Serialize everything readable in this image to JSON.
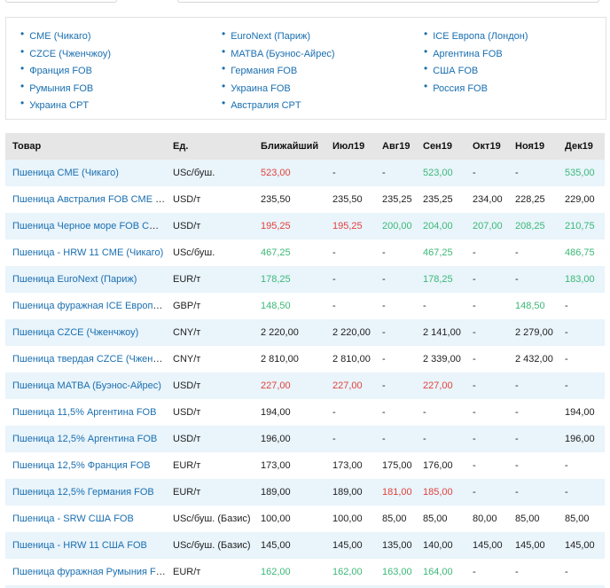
{
  "exchanges": {
    "col1": [
      "CME (Чикаго)",
      "CZCE (Чженчжоу)",
      "Франция FOB",
      "Румыния FOB",
      "Украина CPT"
    ],
    "col2": [
      "EuroNext (Париж)",
      "MATBA (Буэнос-Айрес)",
      "Германия FOB",
      "Украина FOB",
      "Австралия CPT"
    ],
    "col3": [
      "ICE Европа (Лондон)",
      "Аргентина FOB",
      "США FOB",
      "Россия FOB"
    ]
  },
  "colors": {
    "link": "#1a6fb0",
    "red": "#e2423b",
    "green": "#3cb878",
    "alt_row": "#e9f4fb",
    "header_bg": "#e6e6e6"
  },
  "table": {
    "headers": [
      "Товар",
      "Ед.",
      "Ближайший",
      "Июл19",
      "Авг19",
      "Сен19",
      "Окт19",
      "Ноя19",
      "Дек19"
    ],
    "rows": [
      {
        "name": "Пшеница CME (Чикаго)",
        "unit": "USc/буш.",
        "cells": [
          [
            "523,00",
            "red"
          ],
          [
            "-",
            "plain"
          ],
          [
            "-",
            "plain"
          ],
          [
            "523,00",
            "green"
          ],
          [
            "-",
            "plain"
          ],
          [
            "-",
            "plain"
          ],
          [
            "535,00",
            "green"
          ]
        ]
      },
      {
        "name": "Пшеница Австралия FOB CME (Ч…",
        "unit": "USD/т",
        "cells": [
          [
            "235,50",
            "plain"
          ],
          [
            "235,50",
            "plain"
          ],
          [
            "235,25",
            "plain"
          ],
          [
            "235,25",
            "plain"
          ],
          [
            "234,00",
            "plain"
          ],
          [
            "228,25",
            "plain"
          ],
          [
            "229,00",
            "plain"
          ]
        ]
      },
      {
        "name": "Пшеница Черное море FOB CME …",
        "unit": "USD/т",
        "cells": [
          [
            "195,25",
            "red"
          ],
          [
            "195,25",
            "red"
          ],
          [
            "200,00",
            "green"
          ],
          [
            "204,00",
            "green"
          ],
          [
            "207,00",
            "green"
          ],
          [
            "208,25",
            "green"
          ],
          [
            "210,75",
            "green"
          ]
        ]
      },
      {
        "name": "Пшеница - HRW 11 CME (Чикаго)",
        "unit": "USc/буш.",
        "cells": [
          [
            "467,25",
            "green"
          ],
          [
            "-",
            "plain"
          ],
          [
            "-",
            "plain"
          ],
          [
            "467,25",
            "green"
          ],
          [
            "-",
            "plain"
          ],
          [
            "-",
            "plain"
          ],
          [
            "486,75",
            "green"
          ]
        ]
      },
      {
        "name": "Пшеница EuroNext (Париж)",
        "unit": "EUR/т",
        "cells": [
          [
            "178,25",
            "green"
          ],
          [
            "-",
            "plain"
          ],
          [
            "-",
            "plain"
          ],
          [
            "178,25",
            "green"
          ],
          [
            "-",
            "plain"
          ],
          [
            "-",
            "plain"
          ],
          [
            "183,00",
            "green"
          ]
        ]
      },
      {
        "name": "Пшеница фуражная ICE Европа …",
        "unit": "GBP/т",
        "cells": [
          [
            "148,50",
            "green"
          ],
          [
            "-",
            "plain"
          ],
          [
            "-",
            "plain"
          ],
          [
            "-",
            "plain"
          ],
          [
            "-",
            "plain"
          ],
          [
            "148,50",
            "green"
          ],
          [
            "-",
            "plain"
          ]
        ]
      },
      {
        "name": "Пшеница CZCE (Чженчжоу)",
        "unit": "CNY/т",
        "cells": [
          [
            "2 220,00",
            "plain"
          ],
          [
            "2 220,00",
            "plain"
          ],
          [
            "-",
            "plain"
          ],
          [
            "2 141,00",
            "plain"
          ],
          [
            "-",
            "plain"
          ],
          [
            "2 279,00",
            "plain"
          ],
          [
            "-",
            "plain"
          ]
        ]
      },
      {
        "name": "Пшеница твердая CZCE (Чженч…",
        "unit": "CNY/т",
        "cells": [
          [
            "2 810,00",
            "plain"
          ],
          [
            "2 810,00",
            "plain"
          ],
          [
            "-",
            "plain"
          ],
          [
            "2 339,00",
            "plain"
          ],
          [
            "-",
            "plain"
          ],
          [
            "2 432,00",
            "plain"
          ],
          [
            "-",
            "plain"
          ]
        ]
      },
      {
        "name": "Пшеница MATBA (Буэнос-Айрес)",
        "unit": "USD/т",
        "cells": [
          [
            "227,00",
            "red"
          ],
          [
            "227,00",
            "red"
          ],
          [
            "-",
            "plain"
          ],
          [
            "227,00",
            "red"
          ],
          [
            "-",
            "plain"
          ],
          [
            "-",
            "plain"
          ],
          [
            "-",
            "plain"
          ]
        ]
      },
      {
        "name": "Пшеница 11,5% Аргентина FOB",
        "unit": "USD/т",
        "cells": [
          [
            "194,00",
            "plain"
          ],
          [
            "-",
            "plain"
          ],
          [
            "-",
            "plain"
          ],
          [
            "-",
            "plain"
          ],
          [
            "-",
            "plain"
          ],
          [
            "-",
            "plain"
          ],
          [
            "194,00",
            "plain"
          ]
        ]
      },
      {
        "name": "Пшеница 12,5% Аргентина FOB",
        "unit": "USD/т",
        "cells": [
          [
            "196,00",
            "plain"
          ],
          [
            "-",
            "plain"
          ],
          [
            "-",
            "plain"
          ],
          [
            "-",
            "plain"
          ],
          [
            "-",
            "plain"
          ],
          [
            "-",
            "plain"
          ],
          [
            "196,00",
            "plain"
          ]
        ]
      },
      {
        "name": "Пшеница 12,5% Франция FOB",
        "unit": "EUR/т",
        "cells": [
          [
            "173,00",
            "plain"
          ],
          [
            "173,00",
            "plain"
          ],
          [
            "175,00",
            "plain"
          ],
          [
            "176,00",
            "plain"
          ],
          [
            "-",
            "plain"
          ],
          [
            "-",
            "plain"
          ],
          [
            "-",
            "plain"
          ]
        ]
      },
      {
        "name": "Пшеница 12,5% Германия FOB",
        "unit": "EUR/т",
        "cells": [
          [
            "189,00",
            "plain"
          ],
          [
            "189,00",
            "plain"
          ],
          [
            "181,00",
            "red"
          ],
          [
            "185,00",
            "red"
          ],
          [
            "-",
            "plain"
          ],
          [
            "-",
            "plain"
          ],
          [
            "-",
            "plain"
          ]
        ]
      },
      {
        "name": "Пшеница - SRW США FOB",
        "unit": "USc/буш. (Базис)",
        "cells": [
          [
            "100,00",
            "plain"
          ],
          [
            "100,00",
            "plain"
          ],
          [
            "85,00",
            "plain"
          ],
          [
            "85,00",
            "plain"
          ],
          [
            "80,00",
            "plain"
          ],
          [
            "85,00",
            "plain"
          ],
          [
            "85,00",
            "plain"
          ]
        ]
      },
      {
        "name": "Пшеница - HRW 11 США FOB",
        "unit": "USc/буш. (Базис)",
        "cells": [
          [
            "145,00",
            "plain"
          ],
          [
            "145,00",
            "plain"
          ],
          [
            "135,00",
            "plain"
          ],
          [
            "140,00",
            "plain"
          ],
          [
            "145,00",
            "plain"
          ],
          [
            "145,00",
            "plain"
          ],
          [
            "145,00",
            "plain"
          ]
        ]
      },
      {
        "name": "Пшеница фуражная Румыния FOB",
        "unit": "EUR/т",
        "cells": [
          [
            "162,00",
            "green"
          ],
          [
            "162,00",
            "green"
          ],
          [
            "163,00",
            "green"
          ],
          [
            "164,00",
            "green"
          ],
          [
            "-",
            "plain"
          ],
          [
            "-",
            "plain"
          ],
          [
            "-",
            "plain"
          ]
        ]
      }
    ]
  }
}
